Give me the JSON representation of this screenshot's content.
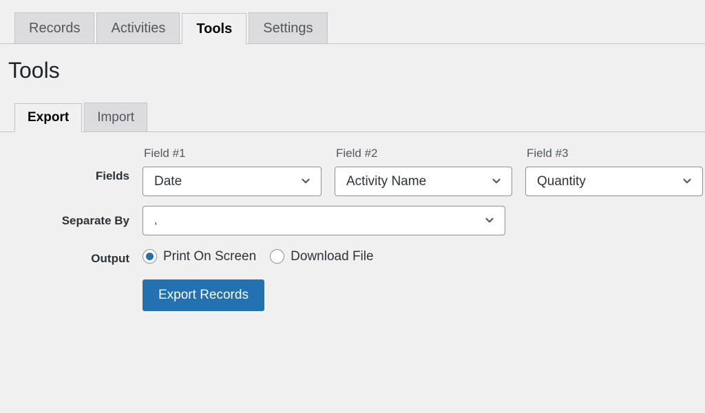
{
  "nav": {
    "tabs": [
      {
        "label": "Records",
        "active": false
      },
      {
        "label": "Activities",
        "active": false
      },
      {
        "label": "Tools",
        "active": true
      },
      {
        "label": "Settings",
        "active": false
      }
    ]
  },
  "page": {
    "title": "Tools"
  },
  "subtabs": [
    {
      "label": "Export",
      "active": true
    },
    {
      "label": "Import",
      "active": false
    }
  ],
  "form": {
    "fields_row": {
      "label": "Fields",
      "columns": [
        {
          "caption": "Field #1",
          "value": "Date"
        },
        {
          "caption": "Field #2",
          "value": "Activity Name"
        },
        {
          "caption": "Field #3",
          "value": "Quantity"
        }
      ]
    },
    "separate_row": {
      "label": "Separate By",
      "value": ","
    },
    "output_row": {
      "label": "Output",
      "options": [
        {
          "label": "Print On Screen",
          "checked": true
        },
        {
          "label": "Download File",
          "checked": false
        }
      ]
    },
    "submit": {
      "label": "Export Records"
    }
  },
  "icons": {
    "chevron_down": "chevron-down-icon"
  },
  "colors": {
    "accent": "#2271b1",
    "page_background": "#f0f0f1",
    "tab_inactive": "#dcdcde",
    "border": "#c3c4c7",
    "input_border": "#8c8f94",
    "heading": "#1d2327",
    "label": "#2c3338",
    "muted_text": "#50575e"
  }
}
